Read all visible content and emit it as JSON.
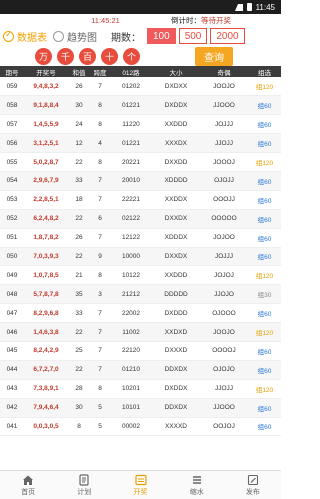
{
  "status": {
    "time": "11:45"
  },
  "timebar": {
    "now": "11:45:21",
    "countdown_label": "倒计时：",
    "countdown_value": "等待开奖"
  },
  "view": {
    "data_table": "数据表",
    "trend_chart": "趋势图"
  },
  "periods": {
    "label": "期数：",
    "options": [
      "100",
      "500",
      "2000"
    ],
    "selected": "100"
  },
  "filters": [
    "万",
    "千",
    "百",
    "十",
    "个"
  ],
  "query_label": "查询",
  "table": {
    "headers": [
      "期号",
      "开奖号",
      "和值",
      "跨度",
      "012路",
      "大小",
      "奇偶",
      "组选"
    ],
    "rows": [
      [
        "059",
        "9,4,8,3,2",
        "26",
        "7",
        "01202",
        "DXDXX",
        "JOOJO",
        "组120"
      ],
      [
        "058",
        "9,1,8,8,4",
        "30",
        "8",
        "01221",
        "DXDDX",
        "JJOOO",
        "组60"
      ],
      [
        "057",
        "1,4,5,5,9",
        "24",
        "8",
        "11220",
        "XXDDD",
        "JOJJJ",
        "组60"
      ],
      [
        "056",
        "3,1,2,5,1",
        "12",
        "4",
        "01221",
        "XXXDX",
        "JJOJJ",
        "组60"
      ],
      [
        "055",
        "5,0,2,8,7",
        "22",
        "8",
        "20221",
        "DXXDD",
        "JOOOJ",
        "组120"
      ],
      [
        "054",
        "2,9,6,7,9",
        "33",
        "7",
        "20010",
        "XDDDD",
        "OJOJJ",
        "组60"
      ],
      [
        "053",
        "2,2,8,5,1",
        "18",
        "7",
        "22221",
        "XXDDX",
        "OOOJJ",
        "组60"
      ],
      [
        "052",
        "6,2,4,8,2",
        "22",
        "6",
        "02122",
        "DXXDX",
        "OOOOO",
        "组60"
      ],
      [
        "051",
        "1,8,7,8,2",
        "26",
        "7",
        "12122",
        "XDDDX",
        "JOJOO",
        "组60"
      ],
      [
        "050",
        "7,0,3,9,3",
        "22",
        "9",
        "10000",
        "DXXDX",
        "JOJJJ",
        "组60"
      ],
      [
        "049",
        "1,0,7,8,5",
        "21",
        "8",
        "10122",
        "XXDDD",
        "JOJOJ",
        "组120"
      ],
      [
        "048",
        "5,7,8,7,8",
        "35",
        "3",
        "21212",
        "DDDDD",
        "JJOJO",
        "组30"
      ],
      [
        "047",
        "8,2,9,6,8",
        "33",
        "7",
        "22002",
        "DXDDD",
        "OJOOO",
        "组60"
      ],
      [
        "046",
        "1,4,6,3,8",
        "22",
        "7",
        "11002",
        "XXDXD",
        "JOOJO",
        "组120"
      ],
      [
        "045",
        "8,2,4,2,9",
        "25",
        "7",
        "22120",
        "DXXXD",
        "OOOOJ",
        "组60"
      ],
      [
        "044",
        "6,7,2,7,0",
        "22",
        "7",
        "01210",
        "DDXDX",
        "OJOJO",
        "组60"
      ],
      [
        "043",
        "7,3,8,9,1",
        "28",
        "8",
        "10201",
        "DXDDX",
        "JJOJJ",
        "组120"
      ],
      [
        "042",
        "7,9,4,6,4",
        "30",
        "5",
        "10101",
        "DDXDX",
        "JJOOO",
        "组60"
      ],
      [
        "041",
        "0,0,3,0,5",
        "8",
        "5",
        "00002",
        "XXXXD",
        "OOJOJ",
        "组60"
      ]
    ]
  },
  "nav": [
    {
      "label": "首页",
      "icon": "home-icon"
    },
    {
      "label": "计划",
      "icon": "plan-icon"
    },
    {
      "label": "开奖",
      "icon": "lottery-icon"
    },
    {
      "label": "缩水",
      "icon": "shrink-icon"
    },
    {
      "label": "发布",
      "icon": "publish-icon"
    }
  ],
  "nav_active": "开奖",
  "colors": {
    "accent": "#f5a623",
    "red": "#e74c3c",
    "blue": "#2b78d8"
  }
}
